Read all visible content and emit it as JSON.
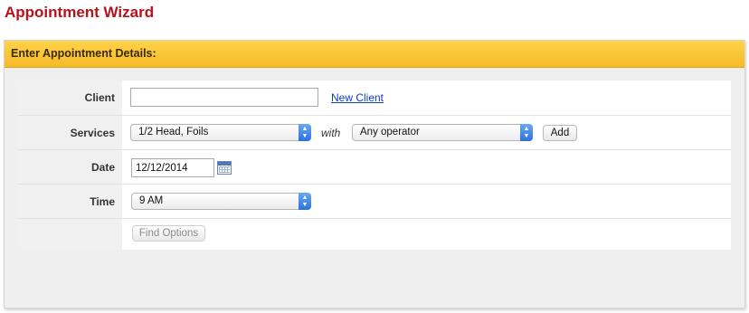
{
  "page": {
    "title": "Appointment Wizard"
  },
  "panel": {
    "header": "Enter Appointment Details:"
  },
  "form": {
    "client": {
      "label": "Client",
      "value": "",
      "new_client_link": "New Client"
    },
    "services": {
      "label": "Services",
      "service_selected": "1/2 Head, Foils",
      "with_text": "with",
      "operator_selected": "Any operator",
      "add_button": "Add"
    },
    "date": {
      "label": "Date",
      "value": "12/12/2014"
    },
    "time": {
      "label": "Time",
      "selected": "9 AM"
    },
    "find_options_button": "Find Options"
  },
  "icons": {
    "select_arrows": "updown-chevron-icon",
    "calendar": "calendar-icon"
  },
  "colors": {
    "title": "#b5121b",
    "header_bg": "#f9c536",
    "select_accent": "#2a73dd",
    "link": "#0b3ccf"
  }
}
